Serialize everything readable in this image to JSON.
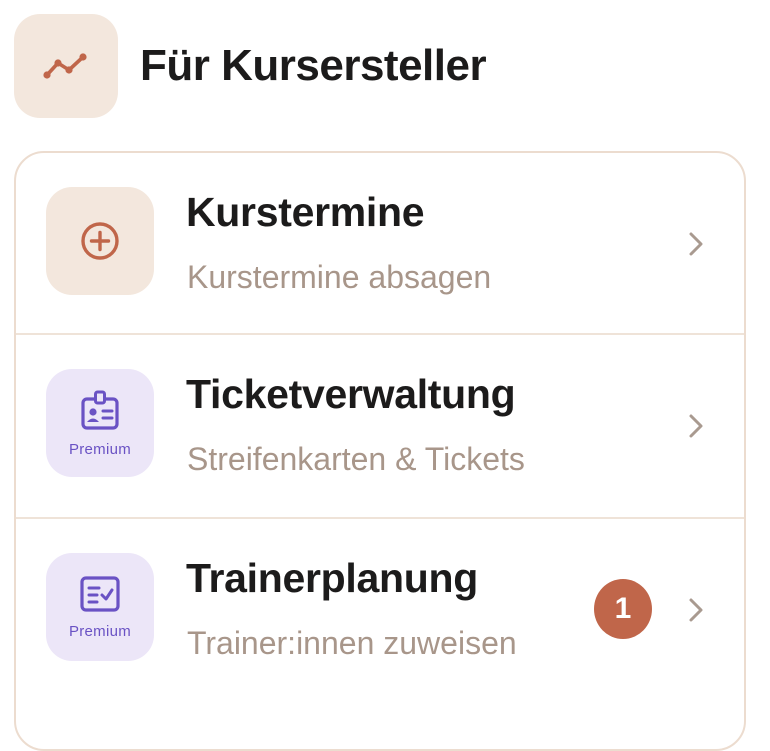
{
  "header": {
    "title": "Für Kursersteller",
    "icon": "trend-line-icon"
  },
  "rows": [
    {
      "title": "Kurstermine",
      "subtitle": "Kurstermine absagen",
      "icon": "plus-circle-icon",
      "premium": false
    },
    {
      "title": "Ticketverwaltung",
      "subtitle": "Streifenkarten & Tickets",
      "icon": "id-badge-icon",
      "premium": true,
      "premium_label": "Premium"
    },
    {
      "title": "Trainerplanung",
      "subtitle": "Trainer:innen zuweisen",
      "icon": "checklist-icon",
      "premium": true,
      "premium_label": "Premium",
      "badge_count": "1"
    }
  ],
  "colors": {
    "accent": "#c0664a",
    "tile_beige": "#f3e7dd",
    "tile_lavender": "#ece6f8",
    "premium_purple": "#6a52c4",
    "subtitle": "#a8968a"
  }
}
